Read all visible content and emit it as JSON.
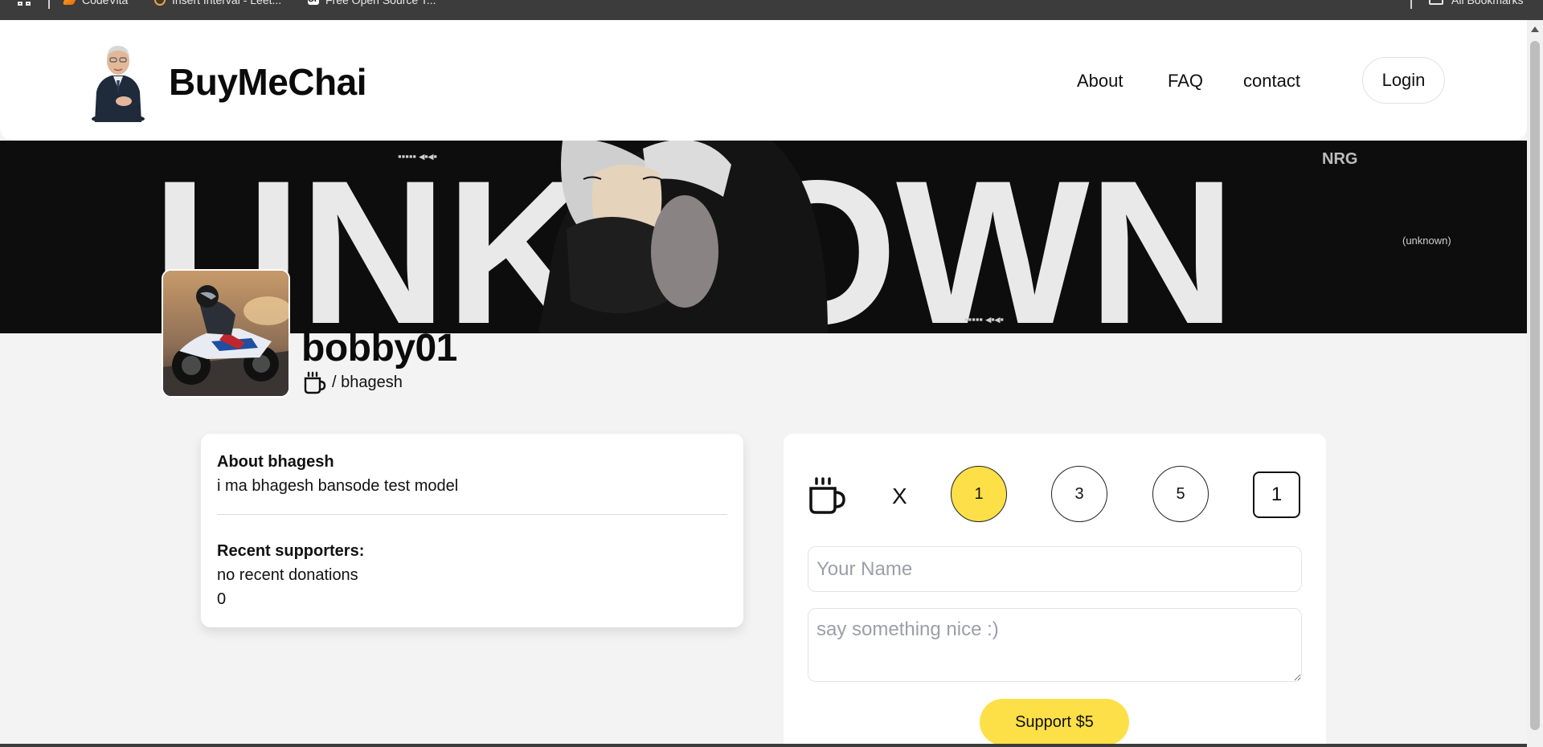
{
  "bookmarks": {
    "items": [
      {
        "label": "CodeVita"
      },
      {
        "label": "Insert Interval - Leet..."
      },
      {
        "label": "Free Open Source T..."
      }
    ],
    "all_bookmarks": "All Bookmarks"
  },
  "header": {
    "brand": "BuyMeChai",
    "nav": [
      "About",
      "FAQ",
      "contact"
    ],
    "login": "Login"
  },
  "cover": {
    "word": "UNKNOWN",
    "tag": "NRG",
    "sub": "(unknown)"
  },
  "profile": {
    "username": "bobby01",
    "handle": "/ bhagesh"
  },
  "about": {
    "heading": "About bhagesh",
    "bio": "i ma bhagesh bansode test model",
    "supporters_heading": "Recent supporters:",
    "supporters_text": "no recent donations",
    "supporters_count": "0"
  },
  "support": {
    "multiplier": "X",
    "amounts": [
      "1",
      "3",
      "5"
    ],
    "selected_amount": "1",
    "quantity": "1",
    "name_placeholder": "Your Name",
    "message_placeholder": "say something nice :)",
    "button": "Support $5",
    "accent_color": "#fde047"
  }
}
